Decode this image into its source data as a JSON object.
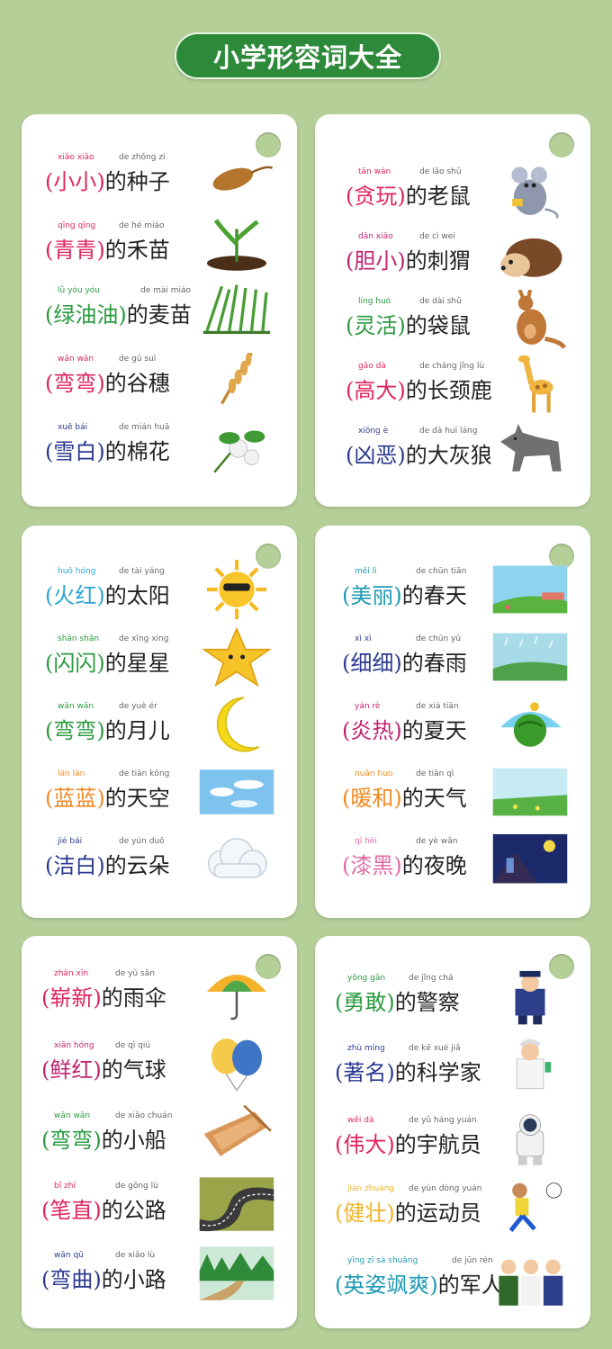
{
  "title": "小学形容词大全",
  "cards": [
    {
      "items": [
        {
          "pinyin_adj": "xiǎo xiǎo",
          "pinyin_rest": "de zhǒng zi",
          "adj": "小小",
          "rest": "的种子",
          "color": "#e0245e",
          "icon": "seed-icon"
        },
        {
          "pinyin_adj": "qīng qīng",
          "pinyin_rest": "de hé miáo",
          "adj": "青青",
          "rest": "的禾苗",
          "color": "#e0245e",
          "icon": "seedling-icon"
        },
        {
          "pinyin_adj": "lǜ yóu yóu",
          "pinyin_rest": "de mài miáo",
          "adj": "绿油油",
          "rest": "的麦苗",
          "color": "#2a9a3f",
          "icon": "wheat-sprout-icon"
        },
        {
          "pinyin_adj": "wān wān",
          "pinyin_rest": "de gǔ suì",
          "adj": "弯弯",
          "rest": "的谷穗",
          "color": "#e0245e",
          "icon": "grain-ear-icon"
        },
        {
          "pinyin_adj": "xuě bái",
          "pinyin_rest": "de mián huā",
          "adj": "雪白",
          "rest": "的棉花",
          "color": "#2b3a8f",
          "icon": "cotton-icon"
        }
      ]
    },
    {
      "items": [
        {
          "pinyin_adj": "tān wán",
          "pinyin_rest": "de lǎo shǔ",
          "adj": "贪玩",
          "rest": "的老鼠",
          "color": "#e0245e",
          "icon": "mouse-icon"
        },
        {
          "pinyin_adj": "dǎn xiǎo",
          "pinyin_rest": "de cì wei",
          "adj": "胆小",
          "rest": "的刺猬",
          "color": "#c02470",
          "icon": "hedgehog-icon"
        },
        {
          "pinyin_adj": "líng huó",
          "pinyin_rest": "de dài shǔ",
          "adj": "灵活",
          "rest": "的袋鼠",
          "color": "#2a9a3f",
          "icon": "kangaroo-icon"
        },
        {
          "pinyin_adj": "gāo dà",
          "pinyin_rest": "de cháng jǐng lù",
          "adj": "高大",
          "rest": "的长颈鹿",
          "color": "#e0245e",
          "icon": "giraffe-icon"
        },
        {
          "pinyin_adj": "xiōng è",
          "pinyin_rest": "de dà huī láng",
          "adj": "凶恶",
          "rest": "的大灰狼",
          "color": "#2b3a8f",
          "icon": "wolf-icon"
        }
      ]
    },
    {
      "items": [
        {
          "pinyin_adj": "huǒ hóng",
          "pinyin_rest": "de tài yáng",
          "adj": "火红",
          "rest": "的太阳",
          "color": "#2aa6d6",
          "icon": "sun-icon"
        },
        {
          "pinyin_adj": "shǎn shǎn",
          "pinyin_rest": "de xīng xing",
          "adj": "闪闪",
          "rest": "的星星",
          "color": "#2a9a3f",
          "icon": "star-icon"
        },
        {
          "pinyin_adj": "wān wān",
          "pinyin_rest": "de yuè ér",
          "adj": "弯弯",
          "rest": "的月儿",
          "color": "#2a9a3f",
          "icon": "moon-icon"
        },
        {
          "pinyin_adj": "lán lán",
          "pinyin_rest": "de tiān kōng",
          "adj": "蓝蓝",
          "rest": "的天空",
          "color": "#f08a24",
          "icon": "sky-icon"
        },
        {
          "pinyin_adj": "jié bái",
          "pinyin_rest": "de yún duǒ",
          "adj": "洁白",
          "rest": "的云朵",
          "color": "#2b3a8f",
          "icon": "cloud-icon"
        }
      ]
    },
    {
      "items": [
        {
          "pinyin_adj": "měi lì",
          "pinyin_rest": "de chūn tiān",
          "adj": "美丽",
          "rest": "的春天",
          "color": "#1f9ab3",
          "icon": "spring-scene-icon"
        },
        {
          "pinyin_adj": "xì xì",
          "pinyin_rest": "de chūn yǔ",
          "adj": "细细",
          "rest": "的春雨",
          "color": "#2b3a8f",
          "icon": "spring-rain-scene-icon"
        },
        {
          "pinyin_adj": "yán rè",
          "pinyin_rest": "de xià tiān",
          "adj": "炎热",
          "rest": "的夏天",
          "color": "#c02470",
          "icon": "watermelon-icon"
        },
        {
          "pinyin_adj": "nuǎn huo",
          "pinyin_rest": "de tiān qì",
          "adj": "暖和",
          "rest": "的天气",
          "color": "#f08a24",
          "icon": "meadow-scene-icon"
        },
        {
          "pinyin_adj": "qī hēi",
          "pinyin_rest": "de yè wǎn",
          "adj": "漆黑",
          "rest": "的夜晚",
          "color": "#e06aa6",
          "icon": "night-scene-icon"
        }
      ]
    },
    {
      "items": [
        {
          "pinyin_adj": "zhǎn xīn",
          "pinyin_rest": "de yǔ sǎn",
          "adj": "崭新",
          "rest": "的雨伞",
          "color": "#e0245e",
          "icon": "umbrella-icon"
        },
        {
          "pinyin_adj": "xiān hóng",
          "pinyin_rest": "de qì qiú",
          "adj": "鲜红",
          "rest": "的气球",
          "color": "#c02470",
          "icon": "balloon-icon"
        },
        {
          "pinyin_adj": "wān wān",
          "pinyin_rest": "de xiǎo chuán",
          "adj": "弯弯",
          "rest": "的小船",
          "color": "#2a9a3f",
          "icon": "boat-icon"
        },
        {
          "pinyin_adj": "bǐ zhí",
          "pinyin_rest": "de gōng lù",
          "adj": "笔直",
          "rest": "的公路",
          "color": "#e0245e",
          "icon": "road-icon"
        },
        {
          "pinyin_adj": "wān qū",
          "pinyin_rest": "de xiǎo lù",
          "adj": "弯曲",
          "rest": "的小路",
          "color": "#2b3a8f",
          "icon": "path-scene-icon"
        }
      ]
    },
    {
      "items": [
        {
          "pinyin_adj": "yǒng gǎn",
          "pinyin_rest": "de jǐng chá",
          "adj": "勇敢",
          "rest": "的警察",
          "color": "#2a9a3f",
          "icon": "police-icon"
        },
        {
          "pinyin_adj": "zhù míng",
          "pinyin_rest": "de kē xué jiā",
          "adj": "著名",
          "rest": "的科学家",
          "color": "#2b3a8f",
          "icon": "scientist-icon"
        },
        {
          "pinyin_adj": "wěi dà",
          "pinyin_rest": "de yǔ háng yuán",
          "adj": "伟大",
          "rest": "的宇航员",
          "color": "#e0245e",
          "icon": "astronaut-icon"
        },
        {
          "pinyin_adj": "jiàn zhuàng",
          "pinyin_rest": "de yùn dòng yuán",
          "adj": "健壮",
          "rest": "的运动员",
          "color": "#f0b424",
          "icon": "athlete-icon"
        },
        {
          "pinyin_adj": "yīng zī sà shuǎng",
          "pinyin_rest": "de jūn rén",
          "adj": "英姿飒爽",
          "rest": "的军人",
          "color": "#1f9ab3",
          "icon": "soldiers-icon"
        }
      ]
    }
  ]
}
